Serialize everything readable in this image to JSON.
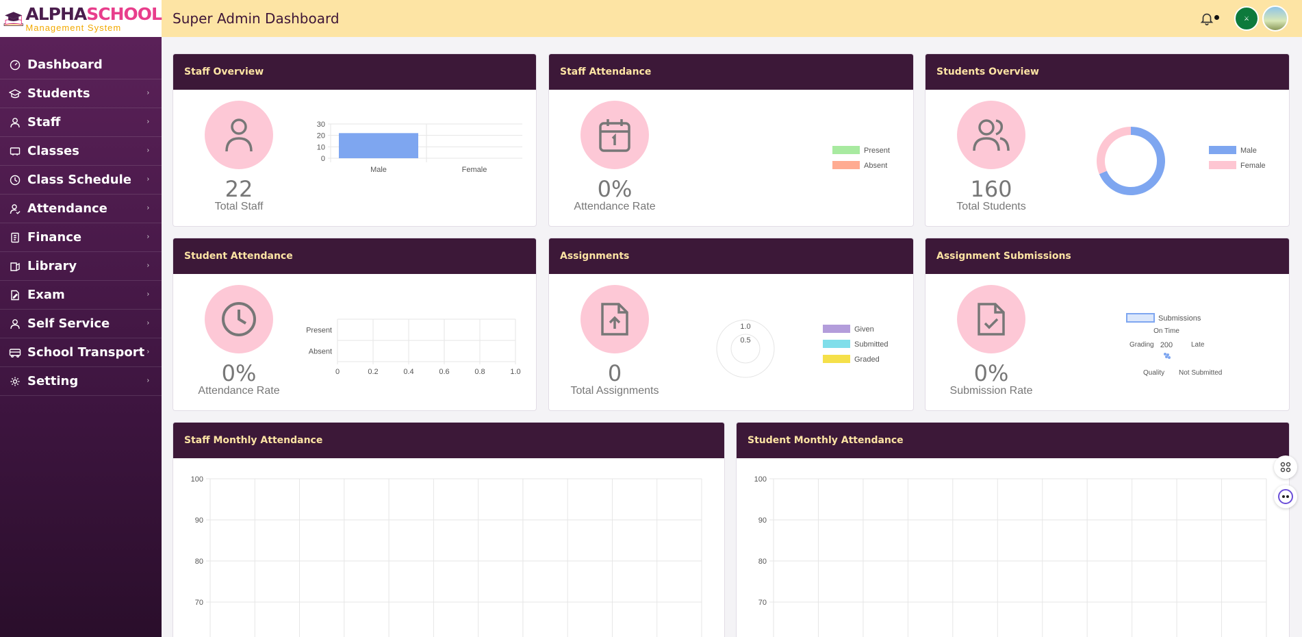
{
  "header": {
    "logo_alpha": "ALPHA",
    "logo_school": "SCHOOL",
    "logo_subtitle": "Management System",
    "title": "Super Admin Dashboard"
  },
  "sidebar": {
    "items": [
      {
        "label": "Dashboard",
        "icon": "dashboard-icon",
        "has_submenu": false
      },
      {
        "label": "Students",
        "icon": "graduation-cap-icon",
        "has_submenu": true
      },
      {
        "label": "Staff",
        "icon": "user-icon",
        "has_submenu": true
      },
      {
        "label": "Classes",
        "icon": "chalkboard-icon",
        "has_submenu": true
      },
      {
        "label": "Class Schedule",
        "icon": "clock-icon",
        "has_submenu": true
      },
      {
        "label": "Attendance",
        "icon": "user-check-icon",
        "has_submenu": true
      },
      {
        "label": "Finance",
        "icon": "receipt-icon",
        "has_submenu": true
      },
      {
        "label": "Library",
        "icon": "book-icon",
        "has_submenu": true
      },
      {
        "label": "Exam",
        "icon": "exam-icon",
        "has_submenu": true
      },
      {
        "label": "Self Service",
        "icon": "user-icon",
        "has_submenu": true
      },
      {
        "label": "School Transport",
        "icon": "bus-icon",
        "has_submenu": true
      },
      {
        "label": "Setting",
        "icon": "gear-icon",
        "has_submenu": true
      }
    ],
    "chevron": "›"
  },
  "cards": {
    "staff_overview": {
      "title": "Staff Overview",
      "value": "22",
      "label": "Total Staff",
      "icon": "user-icon"
    },
    "staff_attendance": {
      "title": "Staff Attendance",
      "value": "0%",
      "label": "Attendance Rate",
      "icon": "calendar-icon"
    },
    "students_overview": {
      "title": "Students Overview",
      "value": "160",
      "label": "Total Students",
      "icon": "users-icon"
    },
    "student_attendance": {
      "title": "Student Attendance",
      "value": "0%",
      "label": "Attendance Rate",
      "icon": "clock-icon"
    },
    "assignments": {
      "title": "Assignments",
      "value": "0",
      "label": "Total Assignments",
      "icon": "file-upload-icon"
    },
    "assignment_submissions": {
      "title": "Assignment Submissions",
      "value": "0%",
      "label": "Submission Rate",
      "icon": "file-check-icon"
    },
    "staff_monthly": {
      "title": "Staff Monthly Attendance"
    },
    "student_monthly": {
      "title": "Student Monthly Attendance"
    }
  },
  "chart_data": [
    {
      "id": "staff_overview",
      "type": "bar",
      "categories": [
        "Male",
        "Female"
      ],
      "values": [
        22,
        0
      ],
      "y_ticks": [
        "30",
        "20",
        "10",
        "0"
      ],
      "ylim": [
        0,
        30
      ],
      "color": "#7ea6f0"
    },
    {
      "id": "staff_attendance",
      "type": "pie",
      "legend": [
        {
          "label": "Present",
          "color": "#a8eaa0"
        },
        {
          "label": "Absent",
          "color": "#ffab91"
        }
      ],
      "values": [
        0,
        0
      ]
    },
    {
      "id": "students_overview",
      "type": "pie",
      "legend": [
        {
          "label": "Male",
          "color": "#7ea6f0"
        },
        {
          "label": "Female",
          "color": "#fec6d2"
        }
      ],
      "values": [
        110,
        50
      ]
    },
    {
      "id": "student_attendance",
      "type": "bar",
      "categories": [
        "Present",
        "Absent"
      ],
      "x_ticks": [
        "0",
        "0.2",
        "0.4",
        "0.6",
        "0.8",
        "1.0"
      ],
      "xlim": [
        0,
        1.0
      ],
      "values": [
        0,
        0
      ]
    },
    {
      "id": "assignments",
      "type": "polar",
      "r_ticks": [
        "1.0",
        "0.5"
      ],
      "legend": [
        {
          "label": "Given",
          "color": "#b39ddb"
        },
        {
          "label": "Submitted",
          "color": "#80deea"
        },
        {
          "label": "Graded",
          "color": "#f5e04a"
        }
      ],
      "values": [
        0,
        0,
        0
      ]
    },
    {
      "id": "assignment_submissions",
      "type": "radar",
      "legend": [
        {
          "label": "Submissions",
          "color": "#7ea6f0"
        }
      ],
      "axes": [
        "On Time",
        "Late",
        "Not Submitted",
        "Quality",
        "Grading"
      ],
      "r_tick": "200"
    },
    {
      "id": "staff_monthly",
      "type": "line",
      "y_ticks": [
        "100",
        "90",
        "80",
        "70"
      ],
      "series": []
    },
    {
      "id": "student_monthly",
      "type": "line",
      "y_ticks": [
        "100",
        "90",
        "80",
        "70"
      ],
      "series": []
    }
  ],
  "floating_buttons": [
    {
      "icon": "command-icon"
    },
    {
      "icon": "assistant-icon"
    }
  ],
  "colors": {
    "header_bg": "#fde4a4",
    "card_header": "#3c1838",
    "card_title": "#fde4a4",
    "stat_circle": "#fdc8d6"
  }
}
